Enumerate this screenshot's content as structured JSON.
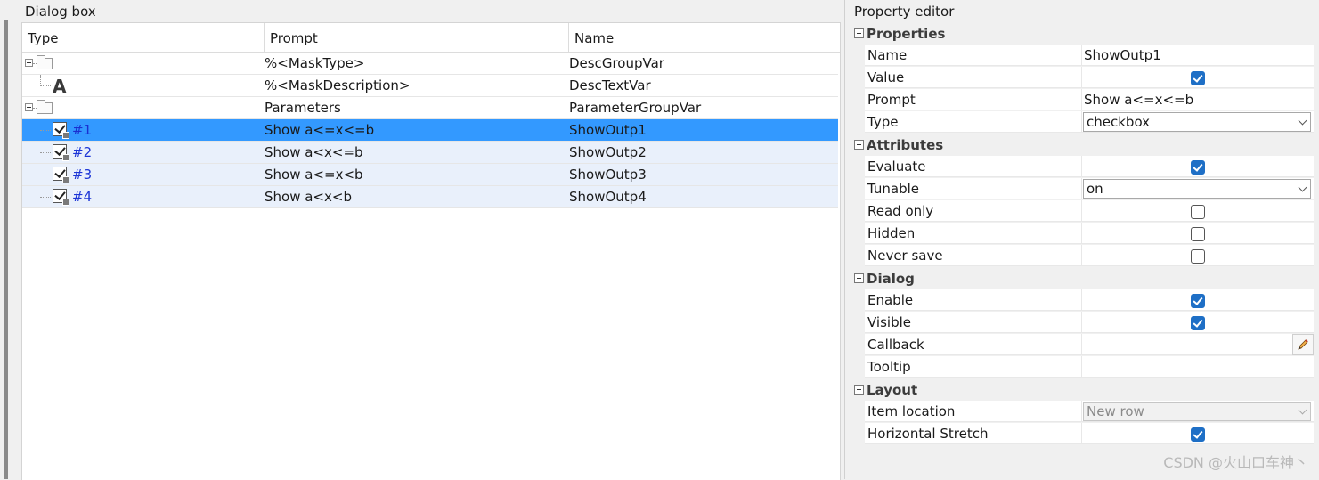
{
  "dialog_box": {
    "title": "Dialog box",
    "columns": [
      "Type",
      "Prompt",
      "Name"
    ],
    "rows": [
      {
        "label": "",
        "prompt": "%<MaskType>",
        "name": "DescGroupVar"
      },
      {
        "label": "",
        "prompt": "%<MaskDescription>",
        "name": "DescTextVar",
        "glyph": "A"
      },
      {
        "label": "",
        "prompt": "Parameters",
        "name": "ParameterGroupVar"
      },
      {
        "label": "#1",
        "prompt": "Show a<=x<=b",
        "name": "ShowOutp1"
      },
      {
        "label": "#2",
        "prompt": "Show a<x<=b",
        "name": "ShowOutp2"
      },
      {
        "label": "#3",
        "prompt": "Show a<=x<b",
        "name": "ShowOutp3"
      },
      {
        "label": "#4",
        "prompt": "Show a<x<b",
        "name": "ShowOutp4"
      }
    ]
  },
  "property_editor": {
    "title": "Property editor",
    "sections": {
      "properties": {
        "label": "Properties",
        "name": {
          "label": "Name",
          "value": "ShowOutp1"
        },
        "value": {
          "label": "Value",
          "checked": true
        },
        "prompt": {
          "label": "Prompt",
          "value": "Show a<=x<=b"
        },
        "type": {
          "label": "Type",
          "value": "checkbox"
        }
      },
      "attributes": {
        "label": "Attributes",
        "evaluate": {
          "label": "Evaluate",
          "checked": true
        },
        "tunable": {
          "label": "Tunable",
          "value": "on"
        },
        "read_only": {
          "label": "Read only",
          "checked": false
        },
        "hidden": {
          "label": "Hidden",
          "checked": false
        },
        "never_save": {
          "label": "Never save",
          "checked": false
        }
      },
      "dialog": {
        "label": "Dialog",
        "enable": {
          "label": "Enable",
          "checked": true
        },
        "visible": {
          "label": "Visible",
          "checked": true
        },
        "callback": {
          "label": "Callback"
        },
        "tooltip": {
          "label": "Tooltip"
        }
      },
      "layout": {
        "label": "Layout",
        "item_location": {
          "label": "Item location",
          "value": "New row"
        },
        "horizontal_stretch": {
          "label": "Horizontal Stretch",
          "checked": true
        }
      }
    }
  },
  "watermark": "CSDN @火山口车神丶",
  "colors": {
    "selection": "#3399ff",
    "parameter_row": "#e9f0fb",
    "checkbox_on": "#1e6fc6",
    "item_label": "#1c35d6"
  }
}
